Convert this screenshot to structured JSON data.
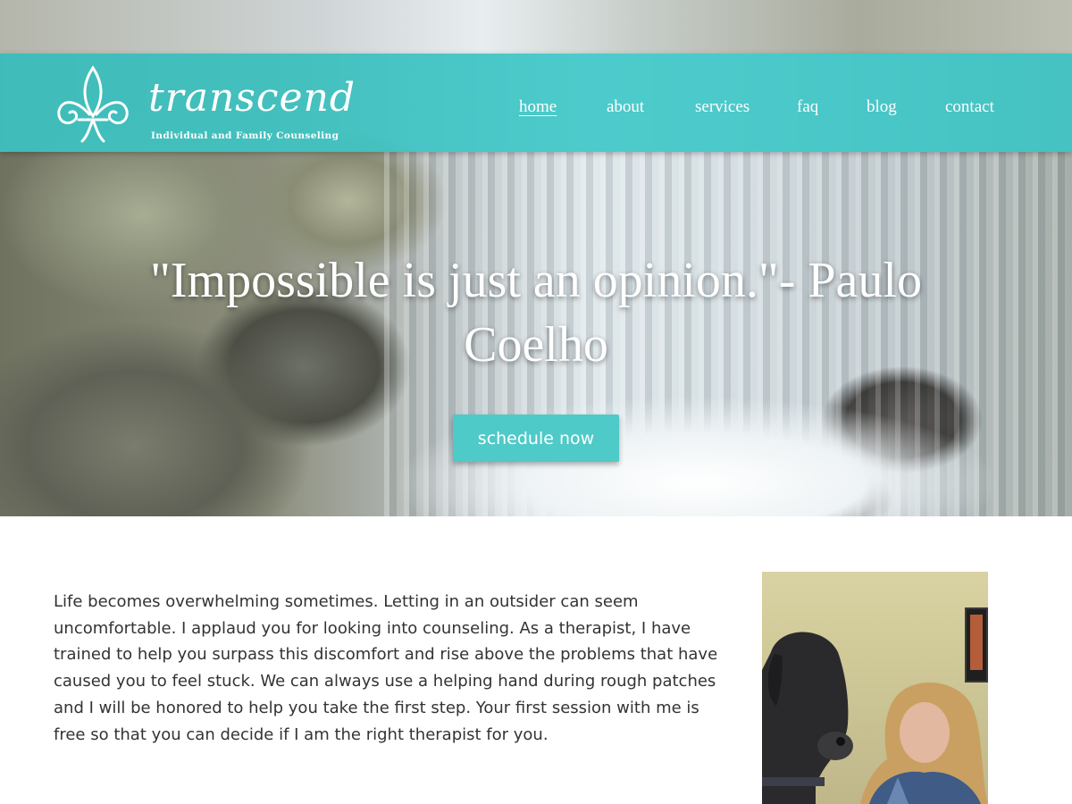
{
  "brand": {
    "name": "transcend",
    "tagline": "Individual and Family Counseling",
    "logo_icon": "fleur-de-lis-icon"
  },
  "nav": {
    "items": [
      {
        "label": "home",
        "active": true
      },
      {
        "label": "about",
        "active": false
      },
      {
        "label": "services",
        "active": false
      },
      {
        "label": "faq",
        "active": false
      },
      {
        "label": "blog",
        "active": false
      },
      {
        "label": "contact",
        "active": false
      }
    ]
  },
  "hero": {
    "quote": "\"Impossible is just an opinion.\"- Paulo Coelho",
    "cta_label": "schedule now"
  },
  "intro": {
    "text": "Life becomes overwhelming sometimes. Letting in an outsider can seem uncomfortable. I applaud you for looking into counseling. As a therapist, I have trained to help you surpass this discomfort and rise above the problems that have caused you to feel stuck. We can always use a helping hand during rough patches and I will be honored to help you take the first step. Your first session with me is free so that you can decide if I am the right therapist for you."
  },
  "colors": {
    "accent": "#39c6c6",
    "button": "#4ecac8",
    "text": "#333333"
  }
}
